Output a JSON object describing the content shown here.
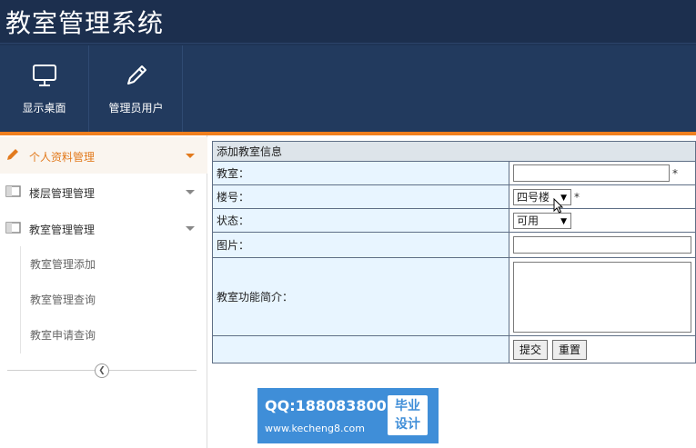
{
  "app": {
    "title": "教室管理系统"
  },
  "nav": {
    "items": [
      {
        "label": "显示桌面",
        "icon": "monitor-icon"
      },
      {
        "label": "管理员用户",
        "icon": "pencil-icon"
      }
    ]
  },
  "sidebar": {
    "groups": [
      {
        "label": "个人资料管理",
        "icon": "pencil-icon",
        "active": true
      },
      {
        "label": "楼层管理管理",
        "icon": "window-icon"
      },
      {
        "label": "教室管理管理",
        "icon": "window-icon"
      }
    ],
    "sub_items": [
      {
        "label": "教室管理添加"
      },
      {
        "label": "教室管理查询"
      },
      {
        "label": "教室申请查询"
      }
    ],
    "collapse_icon": "chevron-left-icon"
  },
  "form": {
    "caption": "添加教室信息",
    "fields": {
      "room": {
        "label": "教室：",
        "value": "",
        "required_mark": "*"
      },
      "building": {
        "label": "楼号：",
        "selected": "四号楼",
        "required_mark": "*"
      },
      "status": {
        "label": "状态：",
        "selected": "可用"
      },
      "image": {
        "label": "图片：",
        "value": ""
      },
      "intro": {
        "label": "教室功能简介：",
        "value": ""
      }
    },
    "buttons": {
      "submit": "提交",
      "reset": "重置"
    }
  },
  "watermark": {
    "qq": "QQ:188083800",
    "url": "www.kecheng8.com",
    "badge_line1": "毕业",
    "badge_line2": "设计"
  },
  "colors": {
    "header_bg": "#1f3456",
    "accent": "#f07f1e",
    "label_cell_bg": "#e8f5ff",
    "watermark_bg": "#3f8ed8"
  }
}
